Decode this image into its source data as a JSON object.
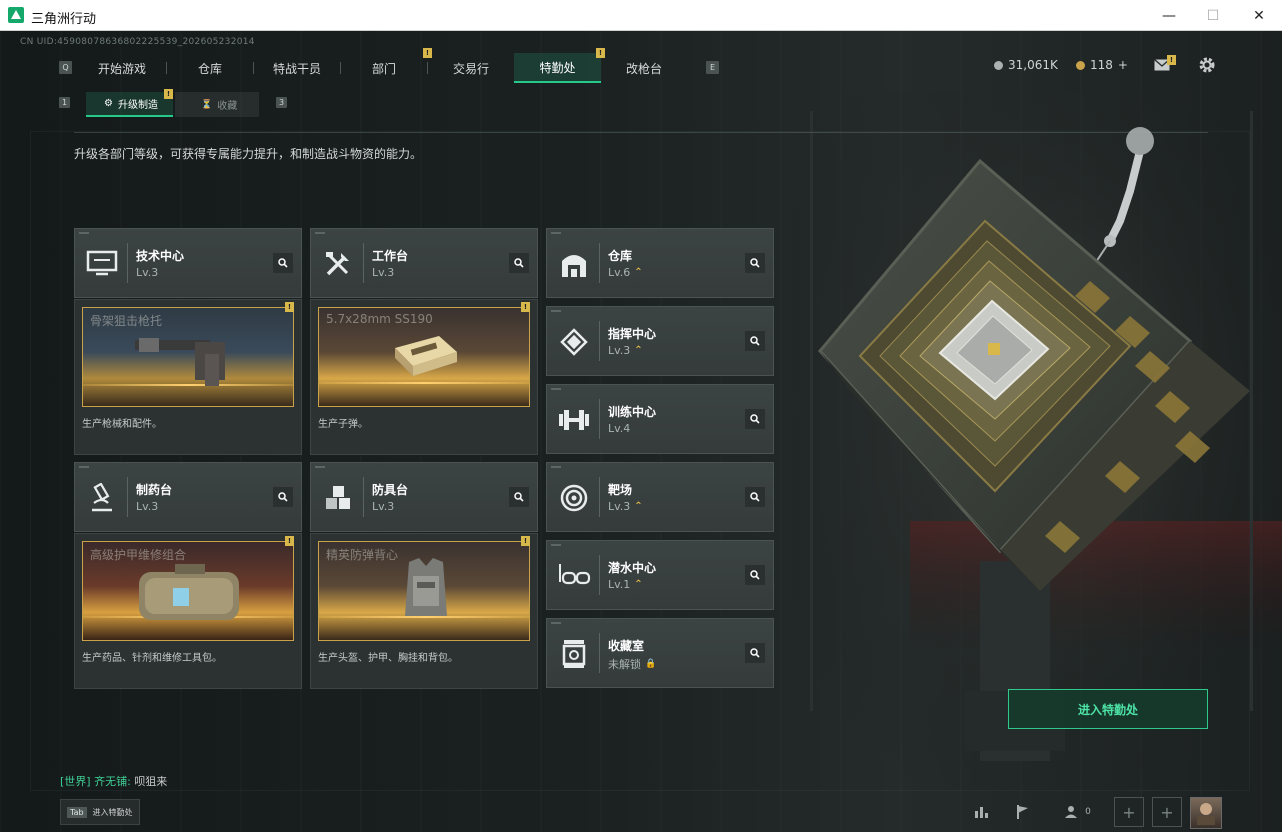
{
  "window": {
    "title": "三角洲行动",
    "minimize": "—",
    "maximize": "☐",
    "close": "✕"
  },
  "uid_text": "CN UID:4590807863680222553​9_202605232014",
  "nav": {
    "left_hint": "Q",
    "right_hint": "E",
    "tabs": [
      {
        "label": "开始游戏"
      },
      {
        "label": "仓库"
      },
      {
        "label": "特战干员"
      },
      {
        "label": "部门",
        "badge": "!"
      },
      {
        "label": "交易行"
      },
      {
        "label": "特勤处",
        "badge": "!",
        "active": true
      },
      {
        "label": "改枪台"
      }
    ]
  },
  "currency": {
    "coins": "31,061K",
    "tokens": "118",
    "plus": "+"
  },
  "subnav": {
    "left_hint": "1",
    "right_hint": "3",
    "tabs": [
      {
        "label": "升级制造",
        "badge": "!"
      },
      {
        "label": "收藏"
      }
    ]
  },
  "description": "升级各部门等级，可获得专属能力提升，和制造战斗物资的能力。",
  "departments": {
    "tech_center": {
      "name": "技术中心",
      "level": "Lv.3"
    },
    "workbench": {
      "name": "工作台",
      "level": "Lv.3"
    },
    "pharmacy": {
      "name": "制药台",
      "level": "Lv.3"
    },
    "armor_bench": {
      "name": "防具台",
      "level": "Lv.3"
    },
    "warehouse": {
      "name": "仓库",
      "level": "Lv.6"
    },
    "command": {
      "name": "指挥中心",
      "level": "Lv.3"
    },
    "training": {
      "name": "训练中心",
      "level": "Lv.4"
    },
    "range": {
      "name": "靶场",
      "level": "Lv.3"
    },
    "diving": {
      "name": "潜水中心",
      "level": "Lv.1"
    },
    "collection": {
      "name": "收藏室",
      "level": "未解锁"
    }
  },
  "productions": {
    "tech": {
      "item": "骨架狙击枪托",
      "desc": "生产枪械和配件。",
      "badge": "!"
    },
    "workbench": {
      "item": "5.7x28mm SS190",
      "desc": "生产子弹。",
      "badge": "!"
    },
    "pharmacy": {
      "item": "高级护甲维修组合",
      "desc": "生产药品、针剂和维修工具包。",
      "badge": "!"
    },
    "armor": {
      "item": "精英防弹背心",
      "desc": "生产头盔、护甲、胸挂和背包。",
      "badge": "!"
    }
  },
  "enter_button": "进入特勤处",
  "chat": {
    "channel": "[世界]",
    "user": "齐无铺:",
    "message": "呗狙来"
  },
  "tab_hint": {
    "key": "Tab",
    "label": "进入特勤处"
  },
  "bottom": {
    "friends_count": "0"
  },
  "colors": {
    "accent": "#27c98a",
    "gold": "#e0b84a",
    "card": "#3a4141"
  }
}
